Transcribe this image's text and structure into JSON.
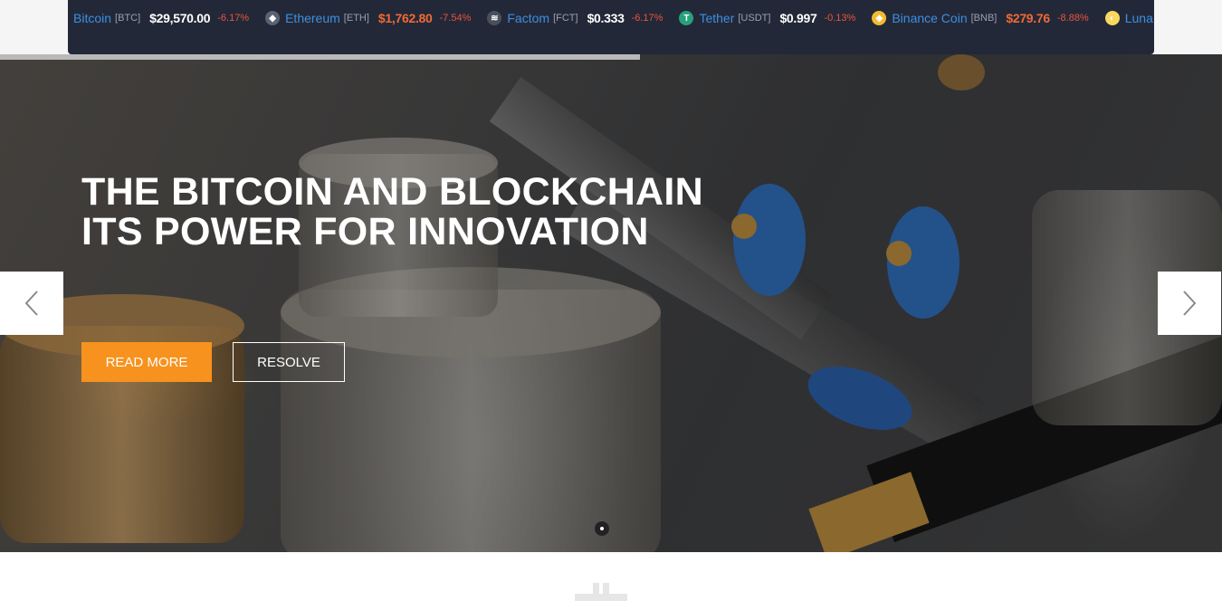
{
  "ticker": {
    "items": [
      {
        "icon": "bitcoin-icon",
        "icon_color": "#f7931a",
        "glyph": "₿",
        "name": "Bitcoin",
        "symbol": "[BTC]",
        "price": "$29,570.00",
        "price_color": "white",
        "change": "-6.17%"
      },
      {
        "icon": "ethereum-icon",
        "icon_color": "#5b6272",
        "glyph": "◆",
        "name": "Ethereum",
        "symbol": "[ETH]",
        "price": "$1,762.80",
        "price_color": "orange",
        "change": "-7.54%"
      },
      {
        "icon": "factom-icon",
        "icon_color": "#4a4f5c",
        "glyph": "≋",
        "name": "Factom",
        "symbol": "[FCT]",
        "price": "$0.333",
        "price_color": "white",
        "change": "-6.17%"
      },
      {
        "icon": "tether-icon",
        "icon_color": "#26a17b",
        "glyph": "T",
        "name": "Tether",
        "symbol": "[USDT]",
        "price": "$0.997",
        "price_color": "white",
        "change": "-0.13%"
      },
      {
        "icon": "binance-coin-icon",
        "icon_color": "#f3ba2f",
        "glyph": "◈",
        "name": "Binance Coin",
        "symbol": "[BNB]",
        "price": "$279.76",
        "price_color": "orange",
        "change": "-8.88%"
      },
      {
        "icon": "luna-icon",
        "icon_color": "#f9d85e",
        "glyph": "◐",
        "name": "Luna",
        "symbol": "",
        "price": "",
        "price_color": "white",
        "change": ""
      }
    ]
  },
  "slider": {
    "headline_line1": "THE BITCOIN AND BLOCKCHAIN",
    "headline_line2": "ITS POWER FOR INNOVATION",
    "read_more_label": "READ MORE",
    "resolve_label": "RESOLVE",
    "progress": 0.524,
    "active_dot": 1,
    "dot_count": 1
  },
  "colors": {
    "accent": "#f7921e",
    "ticker_bg": "#232838",
    "ticker_name": "#3d8fe0",
    "negative_change": "#e8543e"
  }
}
